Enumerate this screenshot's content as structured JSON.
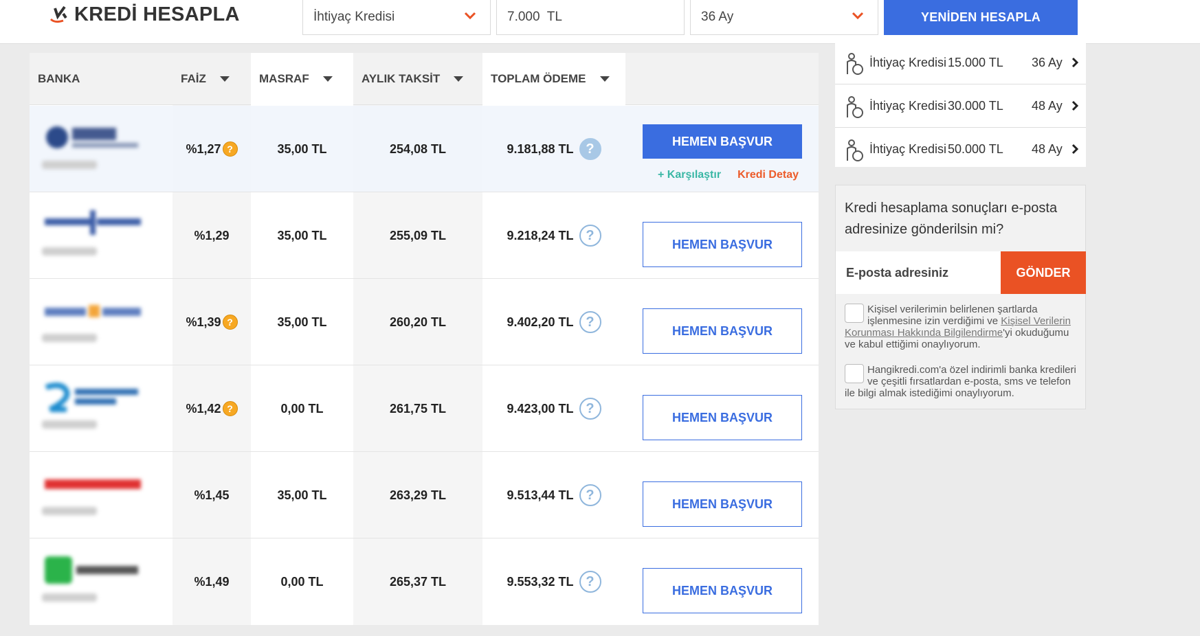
{
  "header": {
    "logo_title": "KREDİ HESAPLA",
    "loan_type": "İhtiyaç Kredisi",
    "amount": "7.000  TL",
    "term": "36 Ay",
    "recalc_label": "YENİDEN HESAPLA"
  },
  "table": {
    "columns": [
      "BANKA",
      "FAİZ",
      "MASRAF",
      "AYLIK TAKSİT",
      "TOPLAM ÖDEME"
    ],
    "rows": [
      {
        "rate": "%1,27",
        "fee": "35,00 TL",
        "monthly": "254,08 TL",
        "total": "9.181,88 TL",
        "apply": "HEMEN BAŞVUR",
        "compare": "+ Karşılaştır",
        "detail": "Kredi Detay"
      },
      {
        "rate": "%1,29",
        "fee": "35,00 TL",
        "monthly": "255,09 TL",
        "total": "9.218,24 TL",
        "apply": "HEMEN BAŞVUR"
      },
      {
        "rate": "%1,39",
        "fee": "35,00 TL",
        "monthly": "260,20 TL",
        "total": "9.402,20 TL",
        "apply": "HEMEN BAŞVUR"
      },
      {
        "rate": "%1,42",
        "fee": "0,00 TL",
        "monthly": "261,75 TL",
        "total": "9.423,00 TL",
        "apply": "HEMEN BAŞVUR"
      },
      {
        "rate": "%1,45",
        "fee": "35,00 TL",
        "monthly": "263,29 TL",
        "total": "9.513,44 TL",
        "apply": "HEMEN BAŞVUR"
      },
      {
        "rate": "%1,49",
        "fee": "0,00 TL",
        "monthly": "265,37 TL",
        "total": "9.553,32 TL",
        "apply": "HEMEN BAŞVUR"
      }
    ],
    "rate_info_icon": "?",
    "total_info_icon": "?"
  },
  "sidebar": {
    "items": [
      {
        "type": "İhtiyaç Kredisi",
        "amount": "15.000 TL",
        "term": "36 Ay"
      },
      {
        "type": "İhtiyaç Kredisi",
        "amount": "30.000 TL",
        "term": "48 Ay"
      },
      {
        "type": "İhtiyaç Kredisi",
        "amount": "50.000 TL",
        "term": "48 Ay"
      }
    ],
    "mail": {
      "title": "Kredi hesaplama sonuçları e-posta adresinize gönderilsin mi?",
      "placeholder": "E-posta adresiniz",
      "send_label": "GÖNDER",
      "consent1_before": "Kişisel verilerimin belirlenen şartlarda işlenmesine izin verdiğimi ve ",
      "consent1_link": "Kişisel Verilerin Korunması Hakkında Bilgilendirme",
      "consent1_after": "'yi okuduğumu ve kabul ettiğimi onaylıyorum.",
      "consent2": "Hangikredi.com'a özel indirimli banka kredileri ve çeşitli fırsatlardan e-posta, sms ve telefon ile bilgi almak istediğimi onaylıyorum."
    }
  },
  "colors": {
    "primary": "#3a6de0",
    "orange": "#ea5224",
    "teal": "#3ab7a5",
    "info_orange": "#f7a823"
  }
}
